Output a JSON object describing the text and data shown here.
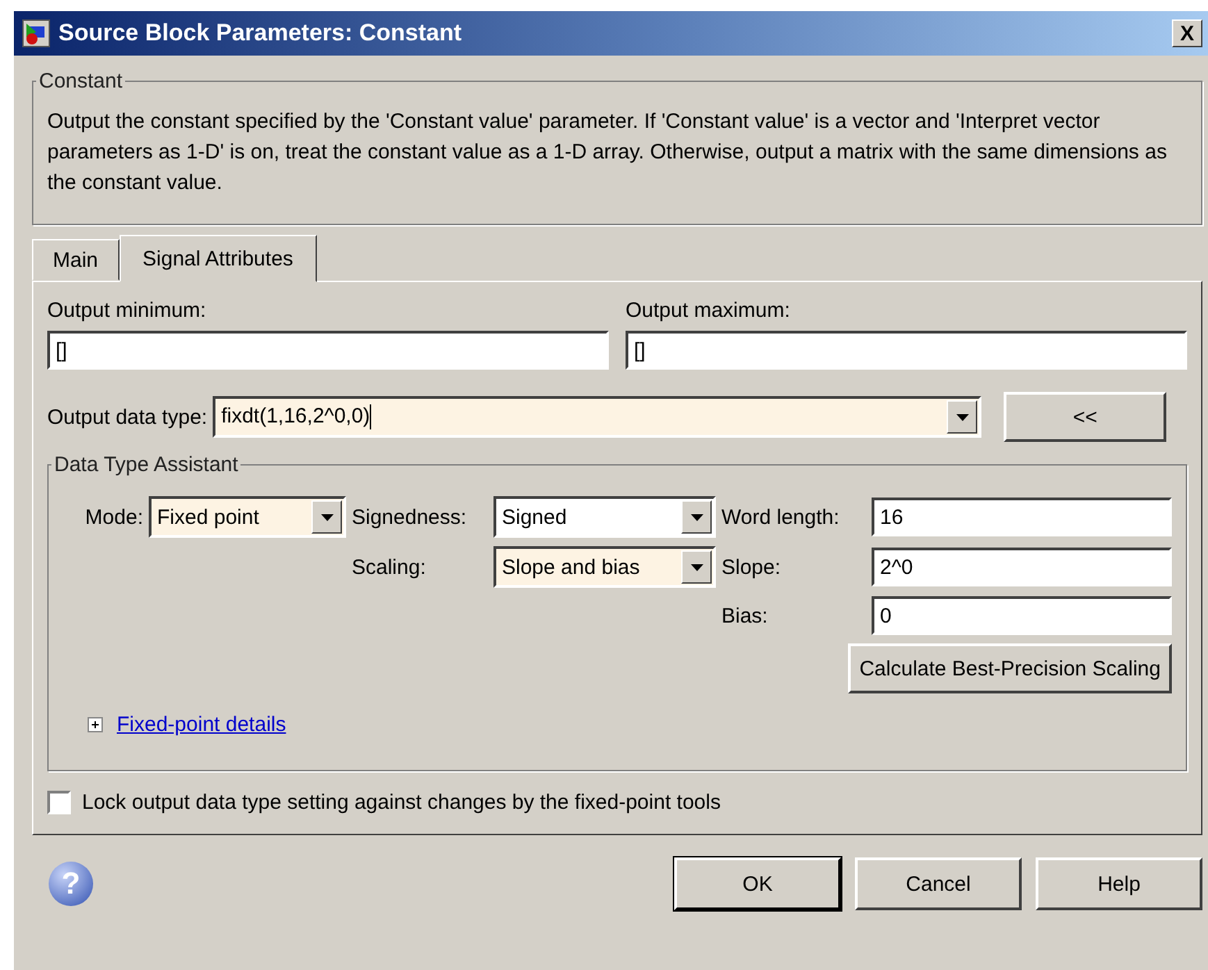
{
  "window": {
    "title": "Source Block Parameters: Constant",
    "close": "X"
  },
  "description": {
    "legend": "Constant",
    "text": "Output the constant specified by the 'Constant value' parameter. If 'Constant value' is a vector and 'Interpret vector parameters as 1-D' is on, treat the constant value as a 1-D array. Otherwise, output a matrix with the same dimensions as the constant value."
  },
  "tabs": [
    {
      "label": "Main",
      "selected": false
    },
    {
      "label": "Signal Attributes",
      "selected": true
    }
  ],
  "output_minimum": {
    "label": "Output minimum:",
    "value": "[]"
  },
  "output_maximum": {
    "label": "Output maximum:",
    "value": "[]"
  },
  "output_data_type": {
    "label": "Output data type:",
    "value": "fixdt(1,16,2^0,0)",
    "toggle": "<<"
  },
  "assistant": {
    "legend": "Data Type Assistant",
    "mode": {
      "label": "Mode:",
      "value": "Fixed point"
    },
    "signedness": {
      "label": "Signedness:",
      "value": "Signed"
    },
    "scaling": {
      "label": "Scaling:",
      "value": "Slope and bias"
    },
    "word_length": {
      "label": "Word length:",
      "value": "16"
    },
    "slope": {
      "label": "Slope:",
      "value": "2^0"
    },
    "bias": {
      "label": "Bias:",
      "value": "0"
    },
    "calculate": "Calculate Best-Precision Scaling",
    "details": {
      "label": "Fixed-point details",
      "expanded": false
    }
  },
  "lock": {
    "label": "Lock output data type setting against changes by the fixed-point tools",
    "checked": false
  },
  "help_icon": "?",
  "buttons": [
    "OK",
    "Cancel",
    "Help"
  ]
}
